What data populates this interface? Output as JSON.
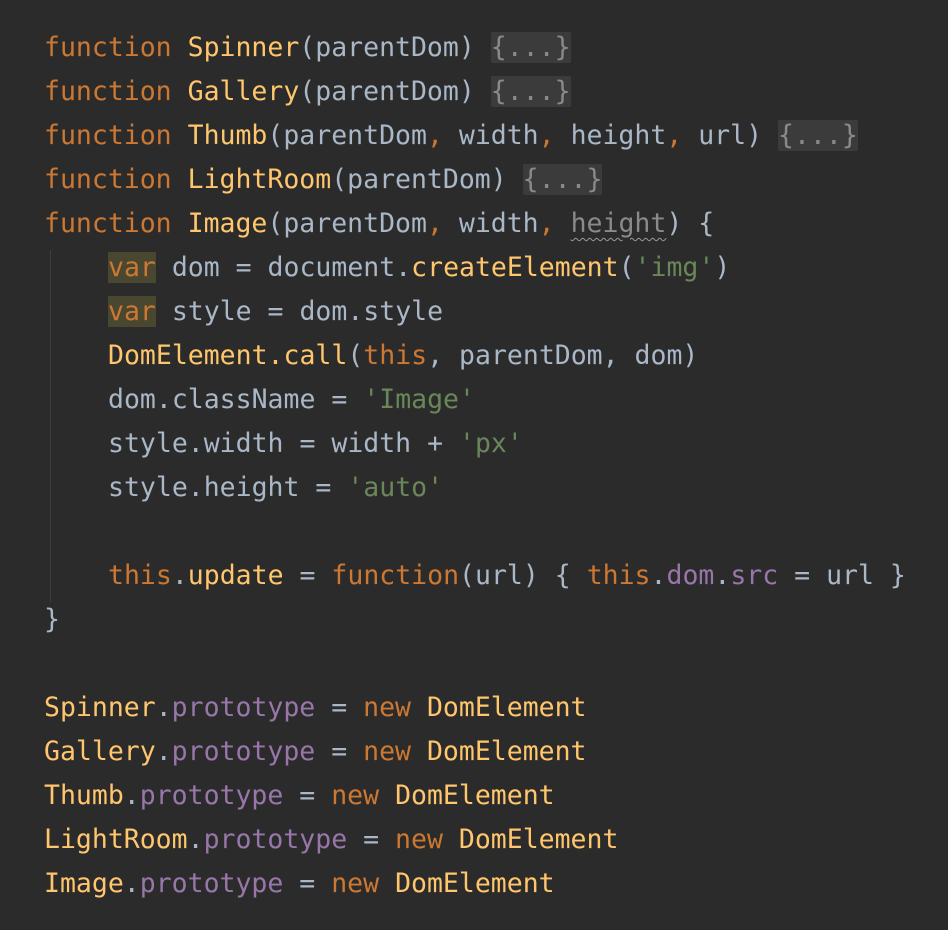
{
  "lines": [
    [
      {
        "t": "function",
        "c": "kw"
      },
      {
        "t": " "
      },
      {
        "t": "Spinner",
        "c": "fn"
      },
      {
        "t": "(parentDom) "
      },
      {
        "t": "{...}",
        "c": "fold"
      }
    ],
    [
      {
        "t": "function",
        "c": "kw"
      },
      {
        "t": " "
      },
      {
        "t": "Gallery",
        "c": "fn"
      },
      {
        "t": "(parentDom) "
      },
      {
        "t": "{...}",
        "c": "fold"
      }
    ],
    [
      {
        "t": "function",
        "c": "kw"
      },
      {
        "t": " "
      },
      {
        "t": "Thumb",
        "c": "fn"
      },
      {
        "t": "(parentDom"
      },
      {
        "t": ",",
        "c": "kw"
      },
      {
        "t": " width"
      },
      {
        "t": ",",
        "c": "kw"
      },
      {
        "t": " height"
      },
      {
        "t": ",",
        "c": "kw"
      },
      {
        "t": " url) "
      },
      {
        "t": "{...}",
        "c": "fold"
      }
    ],
    [
      {
        "t": "function",
        "c": "kw"
      },
      {
        "t": " "
      },
      {
        "t": "LightRoom",
        "c": "fn"
      },
      {
        "t": "(parentDom) "
      },
      {
        "t": "{...}",
        "c": "fold"
      }
    ],
    [
      {
        "t": "function",
        "c": "kw"
      },
      {
        "t": " "
      },
      {
        "t": "Image",
        "c": "fn"
      },
      {
        "t": "(parentDom"
      },
      {
        "t": ",",
        "c": "kw"
      },
      {
        "t": " width"
      },
      {
        "t": ",",
        "c": "kw"
      },
      {
        "t": " "
      },
      {
        "t": "height",
        "c": "squig"
      },
      {
        "t": ") {"
      }
    ],
    {
      "indent": true,
      "tokens": [
        {
          "t": "var",
          "c": "kw hl"
        },
        {
          "t": " dom = document."
        },
        {
          "t": "createElement",
          "c": "fn"
        },
        {
          "t": "("
        },
        {
          "t": "'img'",
          "c": "str"
        },
        {
          "t": ")"
        }
      ]
    },
    {
      "indent": true,
      "tokens": [
        {
          "t": "var",
          "c": "kw hl"
        },
        {
          "t": " style = dom.style"
        }
      ]
    },
    {
      "indent": true,
      "tokens": [
        {
          "t": "DomElement.",
          "c": "fn"
        },
        {
          "t": "call",
          "c": "fn"
        },
        {
          "t": "("
        },
        {
          "t": "this",
          "c": "kw"
        },
        {
          "t": ","
        },
        {
          "t": " parentDom, dom)"
        }
      ]
    },
    {
      "indent": true,
      "tokens": [
        {
          "t": "dom.className = "
        },
        {
          "t": "'Image'",
          "c": "str"
        }
      ]
    },
    {
      "indent": true,
      "tokens": [
        {
          "t": "style.width = width + "
        },
        {
          "t": "'px'",
          "c": "str"
        }
      ]
    },
    {
      "indent": true,
      "tokens": [
        {
          "t": "style.height = "
        },
        {
          "t": "'auto'",
          "c": "str"
        }
      ]
    },
    [],
    {
      "indent": true,
      "tokens": [
        {
          "t": "this",
          "c": "kw"
        },
        {
          "t": "."
        },
        {
          "t": "update",
          "c": "fn"
        },
        {
          "t": " = "
        },
        {
          "t": "function",
          "c": "kw"
        },
        {
          "t": "(url) { "
        },
        {
          "t": "this",
          "c": "kw"
        },
        {
          "t": "."
        },
        {
          "t": "dom",
          "c": "prop"
        },
        {
          "t": "."
        },
        {
          "t": "src",
          "c": "prop"
        },
        {
          "t": " = url }"
        }
      ]
    },
    [
      {
        "t": "}"
      }
    ],
    [],
    [
      {
        "t": "Spinner",
        "c": "fn"
      },
      {
        "t": "."
      },
      {
        "t": "prototype",
        "c": "prop"
      },
      {
        "t": " = "
      },
      {
        "t": "new",
        "c": "kw"
      },
      {
        "t": " "
      },
      {
        "t": "DomElement",
        "c": "fn"
      }
    ],
    [
      {
        "t": "Gallery",
        "c": "fn"
      },
      {
        "t": "."
      },
      {
        "t": "prototype",
        "c": "prop"
      },
      {
        "t": " = "
      },
      {
        "t": "new",
        "c": "kw"
      },
      {
        "t": " "
      },
      {
        "t": "DomElement",
        "c": "fn"
      }
    ],
    [
      {
        "t": "Thumb",
        "c": "fn"
      },
      {
        "t": "."
      },
      {
        "t": "prototype",
        "c": "prop"
      },
      {
        "t": " = "
      },
      {
        "t": "new",
        "c": "kw"
      },
      {
        "t": " "
      },
      {
        "t": "DomElement",
        "c": "fn"
      }
    ],
    [
      {
        "t": "LightRoom",
        "c": "fn"
      },
      {
        "t": "."
      },
      {
        "t": "prototype",
        "c": "prop"
      },
      {
        "t": " = "
      },
      {
        "t": "new",
        "c": "kw"
      },
      {
        "t": " "
      },
      {
        "t": "DomElement",
        "c": "fn"
      }
    ],
    [
      {
        "t": "Image",
        "c": "fn"
      },
      {
        "t": "."
      },
      {
        "t": "prototype",
        "c": "prop"
      },
      {
        "t": " = "
      },
      {
        "t": "new",
        "c": "kw"
      },
      {
        "t": " "
      },
      {
        "t": "DomElement",
        "c": "fn"
      }
    ]
  ],
  "colors": {
    "background": "#2b2b2b",
    "text": "#a9b7c6",
    "keyword": "#cc7832",
    "function": "#ffc66d",
    "string": "#6a8759",
    "property": "#9876aa",
    "fold_background": "#3b3b3b",
    "highlight_background": "#4a4730"
  }
}
